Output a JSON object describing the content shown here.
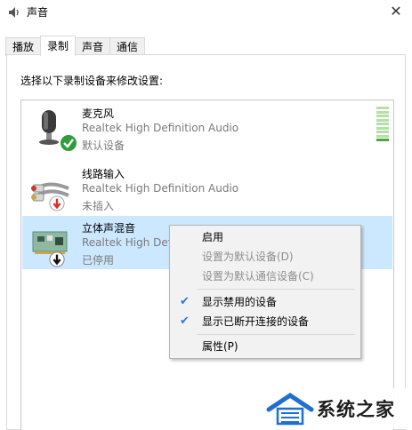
{
  "window": {
    "title": "声音",
    "close_glyph": "✕"
  },
  "tabs": [
    {
      "label": "播放",
      "active": false
    },
    {
      "label": "录制",
      "active": true
    },
    {
      "label": "声音",
      "active": false
    },
    {
      "label": "通信",
      "active": false
    }
  ],
  "instruction": "选择以下录制设备来修改设置:",
  "devices": [
    {
      "name": "麦克风",
      "description": "Realtek High Definition Audio",
      "status": "默认设备",
      "icon": "microphone-icon",
      "badge": "green-check-icon",
      "selected": false,
      "level_meter": true
    },
    {
      "name": "线路输入",
      "description": "Realtek High Definition Audio",
      "status": "未插入",
      "icon": "line-in-cable-icon",
      "badge": "red-down-arrow-icon",
      "selected": false,
      "level_meter": false
    },
    {
      "name": "立体声混音",
      "description": "Realtek High Defi",
      "status": "已停用",
      "icon": "sound-card-icon",
      "badge": "black-down-arrow-icon",
      "selected": true,
      "level_meter": false
    }
  ],
  "context_menu": {
    "items": [
      {
        "label": "启用",
        "enabled": true,
        "checked": false
      },
      {
        "label": "设置为默认设备(D)",
        "enabled": false,
        "checked": false
      },
      {
        "label": "设置为默认通信设备(C)",
        "enabled": false,
        "checked": false
      },
      {
        "label": "显示禁用的设备",
        "enabled": true,
        "checked": true
      },
      {
        "label": "显示已断开连接的设备",
        "enabled": true,
        "checked": true
      },
      {
        "label": "属性(P)",
        "enabled": true,
        "checked": false
      }
    ]
  },
  "watermark": {
    "text": "系统之家"
  },
  "colors": {
    "selection": "#cce8ff",
    "check": "#2b79d6",
    "status_green": "#2e9c3a",
    "status_red": "#d9302c"
  }
}
